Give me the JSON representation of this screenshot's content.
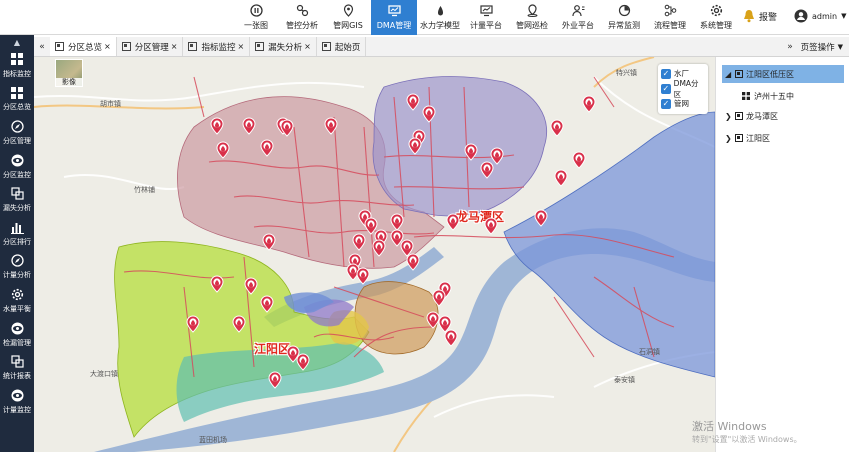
{
  "topnav": {
    "items": [
      {
        "label": "一张图",
        "icon": "pause-circle-icon"
      },
      {
        "label": "管控分析",
        "icon": "analysis-icon"
      },
      {
        "label": "管网GIS",
        "icon": "map-pin-icon"
      },
      {
        "label": "DMA管理",
        "icon": "monitor-icon",
        "active": true
      },
      {
        "label": "水力学模型",
        "icon": "water-drop-icon"
      },
      {
        "label": "计量平台",
        "icon": "chart-screen-icon"
      },
      {
        "label": "管网巡检",
        "icon": "location-icon"
      },
      {
        "label": "外业平台",
        "icon": "users-icon"
      },
      {
        "label": "异常监测",
        "icon": "monitor-icon"
      },
      {
        "label": "流程管理",
        "icon": "flow-icon"
      },
      {
        "label": "系统管理",
        "icon": "gear-icon"
      }
    ],
    "alarm_label": "报警",
    "alarm_count": "",
    "user_name": "admin"
  },
  "sidebar": {
    "items": [
      {
        "label": "指标监控",
        "icon": "grid-icon"
      },
      {
        "label": "分区总览",
        "icon": "grid-icon"
      },
      {
        "label": "分区管理",
        "icon": "compass-icon"
      },
      {
        "label": "分区监控",
        "icon": "eye-icon"
      },
      {
        "label": "漏失分析",
        "icon": "layers-icon"
      },
      {
        "label": "分区排行",
        "icon": "bar-chart-icon"
      },
      {
        "label": "计量分析",
        "icon": "compass-icon"
      },
      {
        "label": "水量平衡",
        "icon": "gear-icon"
      },
      {
        "label": "检漏管理",
        "icon": "eye-icon"
      },
      {
        "label": "统计报表",
        "icon": "layers-icon"
      },
      {
        "label": "计量监控",
        "icon": "eye-icon"
      }
    ]
  },
  "tabs": [
    {
      "label": "分区总览",
      "closable": true,
      "active": true
    },
    {
      "label": "分区管理",
      "closable": true
    },
    {
      "label": "指标监控",
      "closable": true
    },
    {
      "label": "漏失分析",
      "closable": true
    },
    {
      "label": "起始页",
      "closable": false
    }
  ],
  "page_ops_label": "页签操作",
  "map": {
    "basemap_label": "影像",
    "layers": [
      {
        "label": "水厂",
        "checked": true
      },
      {
        "label": "DMA分区",
        "checked": true
      },
      {
        "label": "管网",
        "checked": true
      }
    ],
    "zone_labels": [
      "龙马潭区",
      "江阳区"
    ],
    "place_labels": [
      "胡市镇",
      "特兴镇",
      "竹林铺",
      "泸州十五中",
      "石洞镇",
      "泰安镇",
      "蓝田机场",
      "大渡口镇"
    ]
  },
  "tree": {
    "nodes": [
      {
        "label": "江阳区低压区",
        "level": 0,
        "expanded": true,
        "selected": true
      },
      {
        "label": "泸州十五中",
        "level": 1
      },
      {
        "label": "龙马潭区",
        "level": 0
      },
      {
        "label": "江阳区",
        "level": 0
      }
    ]
  },
  "watermark": {
    "line1": "激活 Windows",
    "line2": "转到\"设置\"以激活 Windows。"
  },
  "colors": {
    "accent": "#2f7fd1",
    "sidebar": "#1f2b3e",
    "pin": "#d9304a",
    "zone_label": "#e0281e"
  }
}
